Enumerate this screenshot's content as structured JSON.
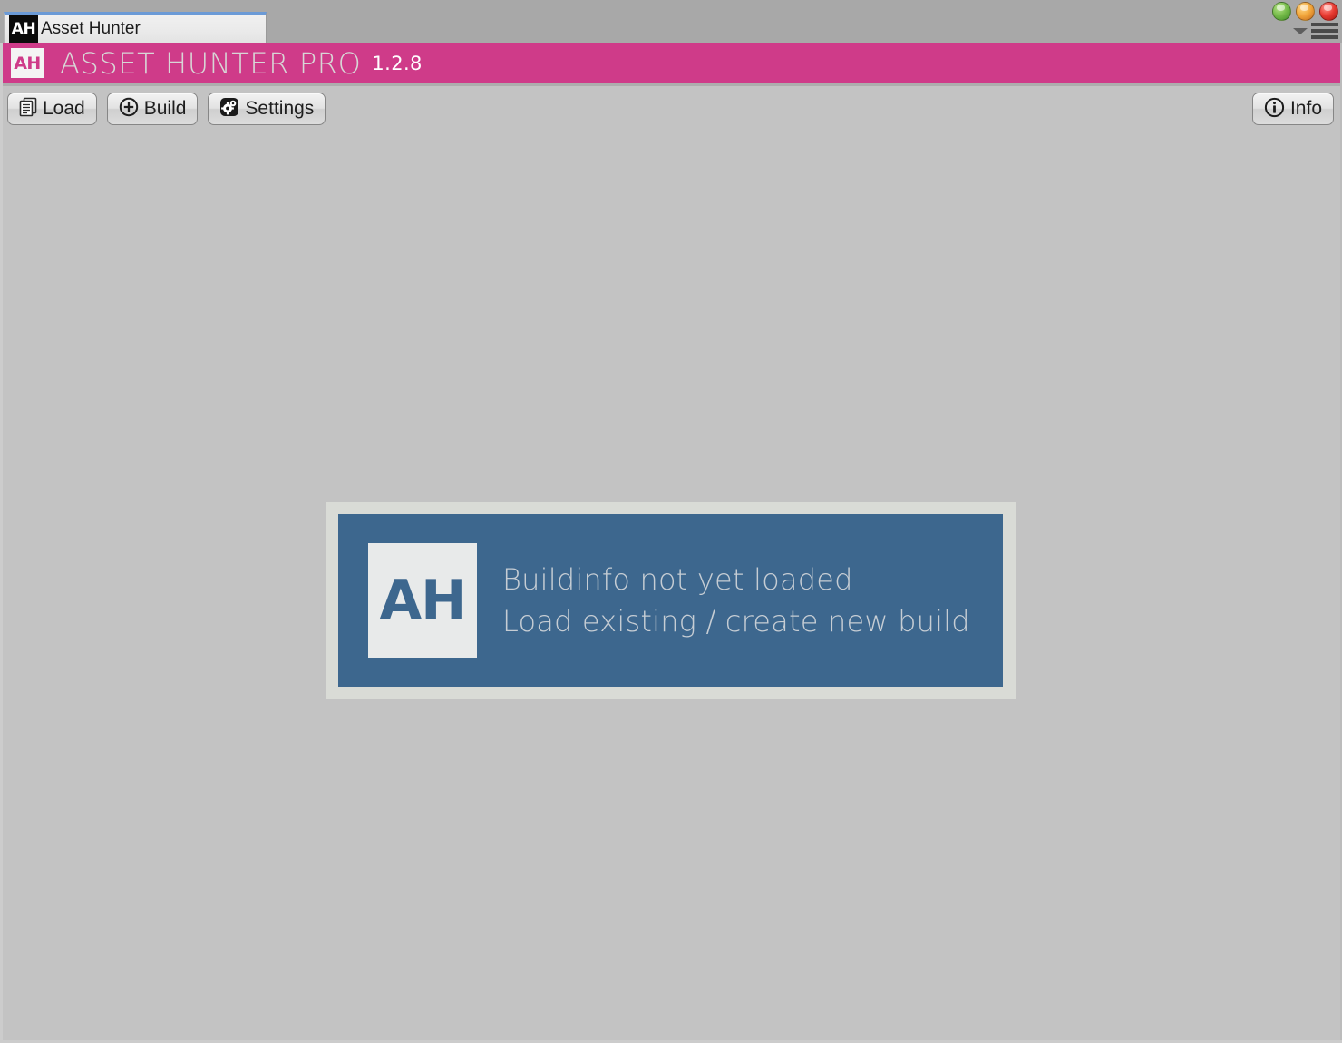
{
  "window": {
    "tab": {
      "badge": "AH",
      "label": "Asset Hunter"
    },
    "controls": {
      "green_name": "minimize-light",
      "amber_name": "maximize-light",
      "red_name": "close-light",
      "menu_name": "window-menu"
    }
  },
  "header": {
    "badge": "AH",
    "title": "ASSET HUNTER PRO",
    "version": "1.2.8",
    "accent_color": "#cf3b89",
    "title_color": "#d8d6d6"
  },
  "toolbar": {
    "buttons": [
      {
        "label": "Load",
        "icon": "documents-icon"
      },
      {
        "label": "Build",
        "icon": "plus-circle-icon"
      },
      {
        "label": "Settings",
        "icon": "gears-icon"
      }
    ],
    "info": {
      "label": "Info",
      "icon": "info-circle-icon"
    }
  },
  "panel": {
    "logo": "AH",
    "line1": "Buildinfo not yet loaded",
    "line2": "Load existing / create new build",
    "panel_color": "#3d678e",
    "frame_color": "#d9dbd6",
    "text_color": "#c6cdd4"
  }
}
